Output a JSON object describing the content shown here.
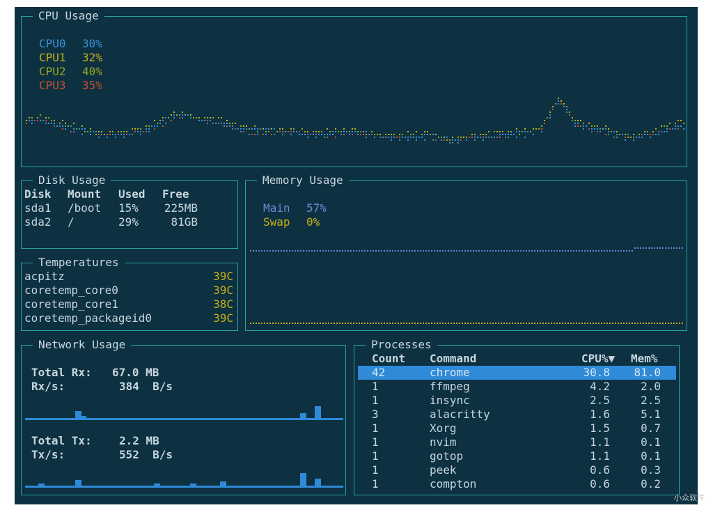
{
  "cpu": {
    "title": "CPU Usage",
    "cores": [
      {
        "label": "CPU0",
        "value": "30%",
        "color": "#3a8fd8"
      },
      {
        "label": "CPU1",
        "value": "32%",
        "color": "#c9b016"
      },
      {
        "label": "CPU2",
        "value": "40%",
        "color": "#9aa61e"
      },
      {
        "label": "CPU3",
        "value": "35%",
        "color": "#c9502e"
      }
    ]
  },
  "disk": {
    "title": "Disk Usage",
    "headers": [
      "Disk",
      "Mount",
      "Used",
      "Free"
    ],
    "rows": [
      [
        "sda1",
        "/boot",
        "15%",
        "225MB"
      ],
      [
        "sda2",
        "/",
        "29%",
        "81GB"
      ]
    ]
  },
  "temps": {
    "title": "Temperatures",
    "rows": [
      {
        "name": "acpitz",
        "value": "39C"
      },
      {
        "name": "coretemp_core0",
        "value": "39C"
      },
      {
        "name": "coretemp_core1",
        "value": "38C"
      },
      {
        "name": "coretemp_packageid0",
        "value": "39C"
      }
    ]
  },
  "memory": {
    "title": "Memory Usage",
    "items": [
      {
        "label": "Main",
        "value": "57%",
        "color": "#6f86d6"
      },
      {
        "label": "Swap",
        "value": "0%",
        "color": "#c9b016"
      }
    ]
  },
  "network": {
    "title": "Network Usage",
    "rx_total_label": "Total Rx:",
    "rx_total_value": "67.0 MB",
    "rx_rate_label": "Rx/s:",
    "rx_rate_value": "384  B/s",
    "tx_total_label": "Total Tx:",
    "tx_total_value": "2.2 MB",
    "tx_rate_label": "Tx/s:",
    "tx_rate_value": "552  B/s"
  },
  "processes": {
    "title": "Processes",
    "headers": {
      "count": "Count",
      "command": "Command",
      "cpu": "CPU%▼",
      "mem": "Mem%"
    },
    "rows": [
      {
        "count": "42",
        "command": "chrome",
        "cpu": "30.8",
        "mem": "81.0",
        "selected": true
      },
      {
        "count": "1",
        "command": "ffmpeg",
        "cpu": "4.2",
        "mem": "2.0"
      },
      {
        "count": "1",
        "command": "insync",
        "cpu": "2.5",
        "mem": "2.5"
      },
      {
        "count": "3",
        "command": "alacritty",
        "cpu": "1.6",
        "mem": "5.1"
      },
      {
        "count": "1",
        "command": "Xorg",
        "cpu": "1.5",
        "mem": "0.7"
      },
      {
        "count": "1",
        "command": "nvim",
        "cpu": "1.1",
        "mem": "0.1"
      },
      {
        "count": "1",
        "command": "gotop",
        "cpu": "1.1",
        "mem": "0.1"
      },
      {
        "count": "1",
        "command": "peek",
        "cpu": "0.6",
        "mem": "0.3"
      },
      {
        "count": "1",
        "command": "compton",
        "cpu": "0.6",
        "mem": "0.2"
      }
    ]
  },
  "watermark": "小众软件",
  "colors": {
    "background": "#0d3141",
    "border": "#2aa3a3",
    "text": "#c7d6de",
    "highlight": "#2f8ad8",
    "bar": "#2f8ad8"
  }
}
